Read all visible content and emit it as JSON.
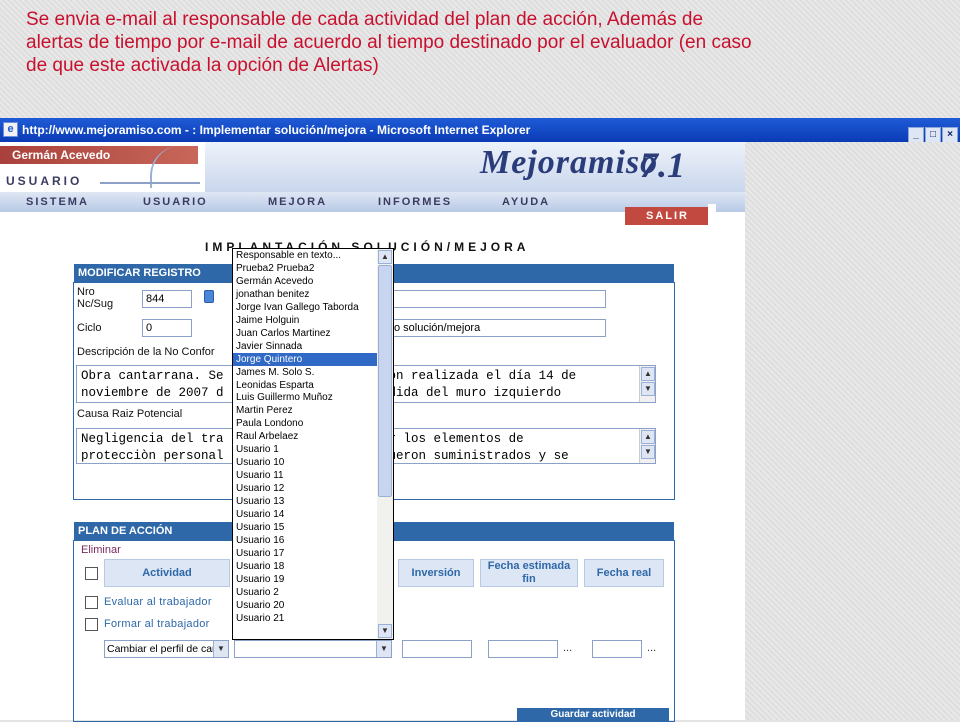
{
  "caption": {
    "line1": "Se envia  e-mail al responsable de cada  actividad del plan de acción,  Además de",
    "line2": " alertas de tiempo por e-mail de acuerdo al tiempo destinado por el evaluador (en caso",
    "line3": "de que este activada la opción de Alertas)"
  },
  "window": {
    "title": "http://www.mejoramiso.com - : Implementar solución/mejora - Microsoft Internet Explorer",
    "buttons": [
      "_",
      "□",
      "×"
    ]
  },
  "header": {
    "user_name": "Germán Acevedo",
    "usuario_label": "USUARIO",
    "logo": "Mejoramiso",
    "version": "7.1",
    "menu": [
      "SISTEMA",
      "USUARIO",
      "MEJORA",
      "INFORMES",
      "AYUDA"
    ],
    "salir": "SALIR"
  },
  "page_title": "IMPLANTACIÓN SOLUCIÓN/MEJORA",
  "form": {
    "section_title": "MODIFICAR REGISTRO",
    "nro_label": "Nro Nc/Sug",
    "nro_value": "844",
    "ciclo_label": "Ciclo",
    "ciclo_value": "0",
    "field2_value": "o solución/mejora",
    "descripcion_label": "Descripción de la No Confor",
    "descripcion_line1": "Obra cantarrana. Se                    ción realizada el día 14 de",
    "descripcion_line2": "noviembre de 2007 d                   fundida del muro izquierdo",
    "causa_label": "Causa Raiz Potencial",
    "causa_line1": "Negligencia del tra                   usar los elementos de",
    "causa_line2": "protecciòn personal                   e fueron suministrados y se"
  },
  "plan": {
    "title": "PLAN DE ACCIÓN",
    "eliminar": "Eliminar",
    "columns": {
      "actividad": "Actividad",
      "inversion": "Inversión",
      "fecha_fin": "Fecha estimada fin",
      "fecha_real": "Fecha real"
    },
    "rows": [
      "Evaluar al trabajador",
      "Formar al trabajador"
    ],
    "new_activity_select": "Cambiar el perfil de cargo",
    "dots": "...",
    "save_button": "Guardar actividad"
  },
  "dropdown": {
    "selected": "Jorge Quintero",
    "options": [
      "Responsable en texto...",
      "Prueba2 Prueba2",
      "Germán Acevedo",
      "jonathan benitez",
      "Jorge Ivan Gallego Taborda",
      "Jaime Holguin",
      "Juan Carlos Martinez",
      "Javier Sinnada",
      "Jorge Quintero",
      "James M. Solo S.",
      "Leonidas Esparta",
      "Luis Guillermo Muñoz",
      "Martin Perez",
      "Paula Londono",
      "Raul Arbelaez",
      "Usuario 1",
      "Usuario 10",
      "Usuario 11",
      "Usuario 12",
      "Usuario 13",
      "Usuario 14",
      "Usuario 15",
      "Usuario 16",
      "Usuario 17",
      "Usuario 18",
      "Usuario 19",
      "Usuario 2",
      "Usuario 20",
      "Usuario 21"
    ]
  },
  "colors": {
    "caption_red": "#c8102e",
    "panel_blue": "#2e68a8",
    "selection_blue": "#3169c6"
  }
}
